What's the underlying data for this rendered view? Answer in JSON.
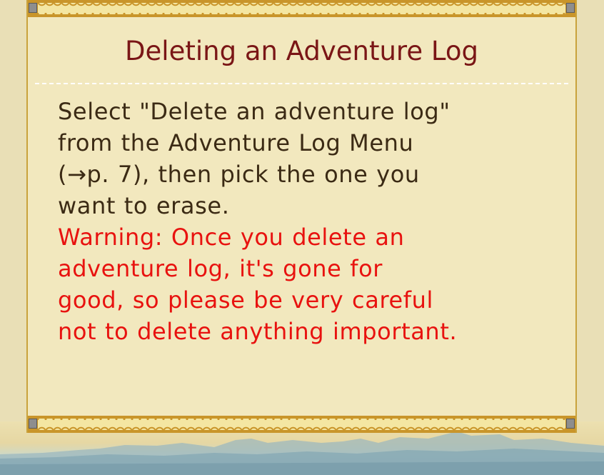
{
  "panel": {
    "title": "Deleting an Adventure Log",
    "body_lines": [
      "Select \"Delete an adventure log\"",
      "from the Adventure Log Menu",
      "(→p. 7), then pick the one you",
      "want to erase."
    ],
    "warning_lines": [
      "Warning: Once you delete an",
      "adventure log, it's gone for",
      "good, so please be very careful",
      "not to delete anything important."
    ]
  },
  "colors": {
    "title": "#7a1616",
    "body": "#3b2a14",
    "warning": "#e8120f",
    "panel_bg": "#f2e8be",
    "border_gold": "#c9952a"
  }
}
